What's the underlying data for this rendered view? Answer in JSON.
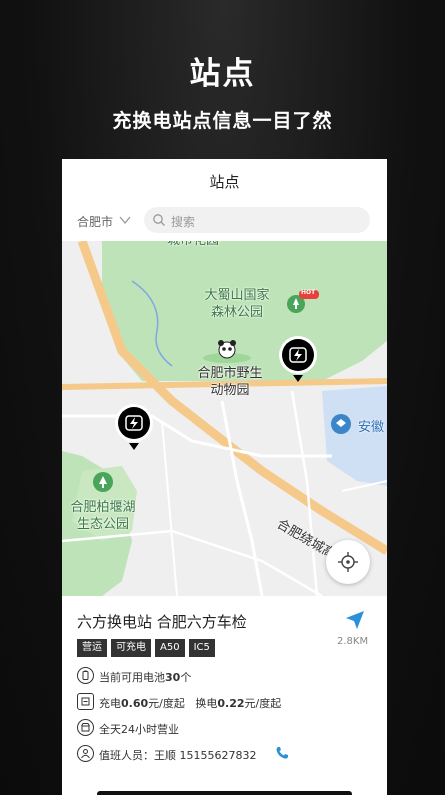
{
  "promo": {
    "title": "站点",
    "subtitle": "充换电站点信息一目了然"
  },
  "header": {
    "title": "站点"
  },
  "search": {
    "city": "合肥市",
    "placeholder": "搜索"
  },
  "map": {
    "labels": {
      "top_cut": "城市花园",
      "park": "大蜀山国家\n森林公园",
      "hot_badge": "HOT",
      "zoo": "合肥市野生\n动物园",
      "anhui": "安徽",
      "wetland": "合肥柏堰湖\n生态公园",
      "ring_road": "合肥绕城高速"
    }
  },
  "station": {
    "name": "六方换电站 合肥六方车检",
    "tags": [
      "营运",
      "可充电",
      "A50",
      "IC5"
    ],
    "distance": "2.8KM",
    "battery_prefix": "当前可用电池",
    "battery_count": "30",
    "battery_suffix": "个",
    "charge_label": "充电",
    "charge_price": "0.60",
    "charge_unit": "元/度起",
    "swap_label": "换电",
    "swap_price": "0.22",
    "swap_unit": "元/度起",
    "hours": "全天24小时营业",
    "staff_label": "值班人员：王顺 15155627832"
  },
  "colors": {
    "park_green": "#bfe3b8",
    "road_orange": "#f5c98a",
    "water_blue": "#cfe0f5",
    "nav_accent": "#2a90d8"
  }
}
